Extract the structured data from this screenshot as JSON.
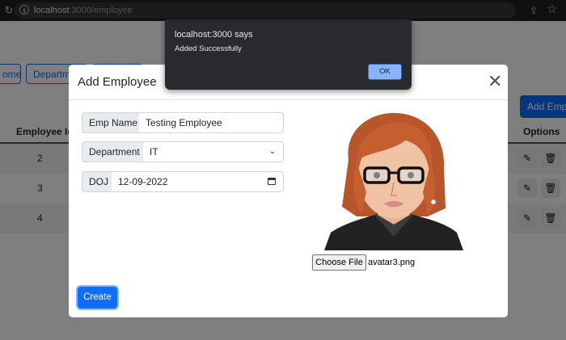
{
  "browser": {
    "url_host": "localhost",
    "url_rest": ":3000/employee"
  },
  "page": {
    "nav": [
      "ome",
      "Departme",
      ""
    ],
    "add_button": "Add Emplo",
    "table": {
      "columns": [
        "Employee Id",
        "Options"
      ],
      "rows": [
        {
          "id": "2"
        },
        {
          "id": "3"
        },
        {
          "id": "4"
        }
      ]
    }
  },
  "modal": {
    "title": "Add Employee",
    "fields": {
      "name": {
        "label": "Emp Name",
        "value": "Testing Employee"
      },
      "department": {
        "label": "Department",
        "value": "IT"
      },
      "doj": {
        "label": "DOJ",
        "value": "12-09-2022"
      }
    },
    "choose_file": "Choose File",
    "file_name": "avatar3.png",
    "create_button": "Create"
  },
  "alert": {
    "origin": "localhost:3000 says",
    "message": "Added Successfully",
    "ok": "OK"
  },
  "colors": {
    "primary": "#0d6efd",
    "alert_bg": "#292a2d",
    "alert_ok": "#8ab4f8"
  }
}
